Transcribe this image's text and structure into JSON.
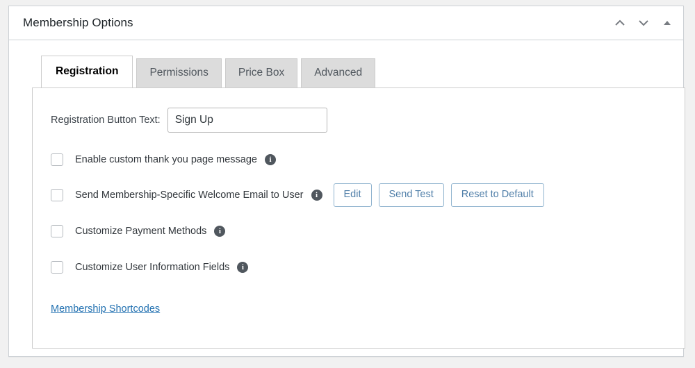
{
  "panel": {
    "title": "Membership Options",
    "header_actions": [
      {
        "name": "move-up-button",
        "icon": "chevron-up-icon"
      },
      {
        "name": "move-down-button",
        "icon": "chevron-down-icon"
      },
      {
        "name": "toggle-panel-button",
        "icon": "triangle-up-icon"
      }
    ]
  },
  "tabs": [
    {
      "label": "Registration",
      "active": true
    },
    {
      "label": "Permissions",
      "active": false
    },
    {
      "label": "Price Box",
      "active": false
    },
    {
      "label": "Advanced",
      "active": false
    }
  ],
  "form": {
    "registration_button_text": {
      "label": "Registration Button Text:",
      "value": "Sign Up",
      "placeholder": ""
    },
    "checkboxes": [
      {
        "label": "Enable custom thank you page message",
        "checked": false,
        "info": "i"
      },
      {
        "label": "Send Membership-Specific Welcome Email to User",
        "checked": false,
        "info": "i",
        "buttons": [
          "Edit",
          "Send Test",
          "Reset to Default"
        ]
      },
      {
        "label": "Customize Payment Methods",
        "checked": false,
        "info": "i"
      },
      {
        "label": "Customize User Information Fields",
        "checked": false,
        "info": "i"
      }
    ],
    "shortcodes_link": "Membership Shortcodes"
  },
  "colors": {
    "page_background": "#f1f1f1",
    "panel_background": "#ffffff",
    "panel_border": "#ccd0d4",
    "tab_inactive_bg": "#dcdcdc",
    "link_blue": "#2271b1",
    "button_blue": "#4f7ea8",
    "button_border_blue": "#8fb3ce",
    "info_icon_bg": "#50575e"
  }
}
